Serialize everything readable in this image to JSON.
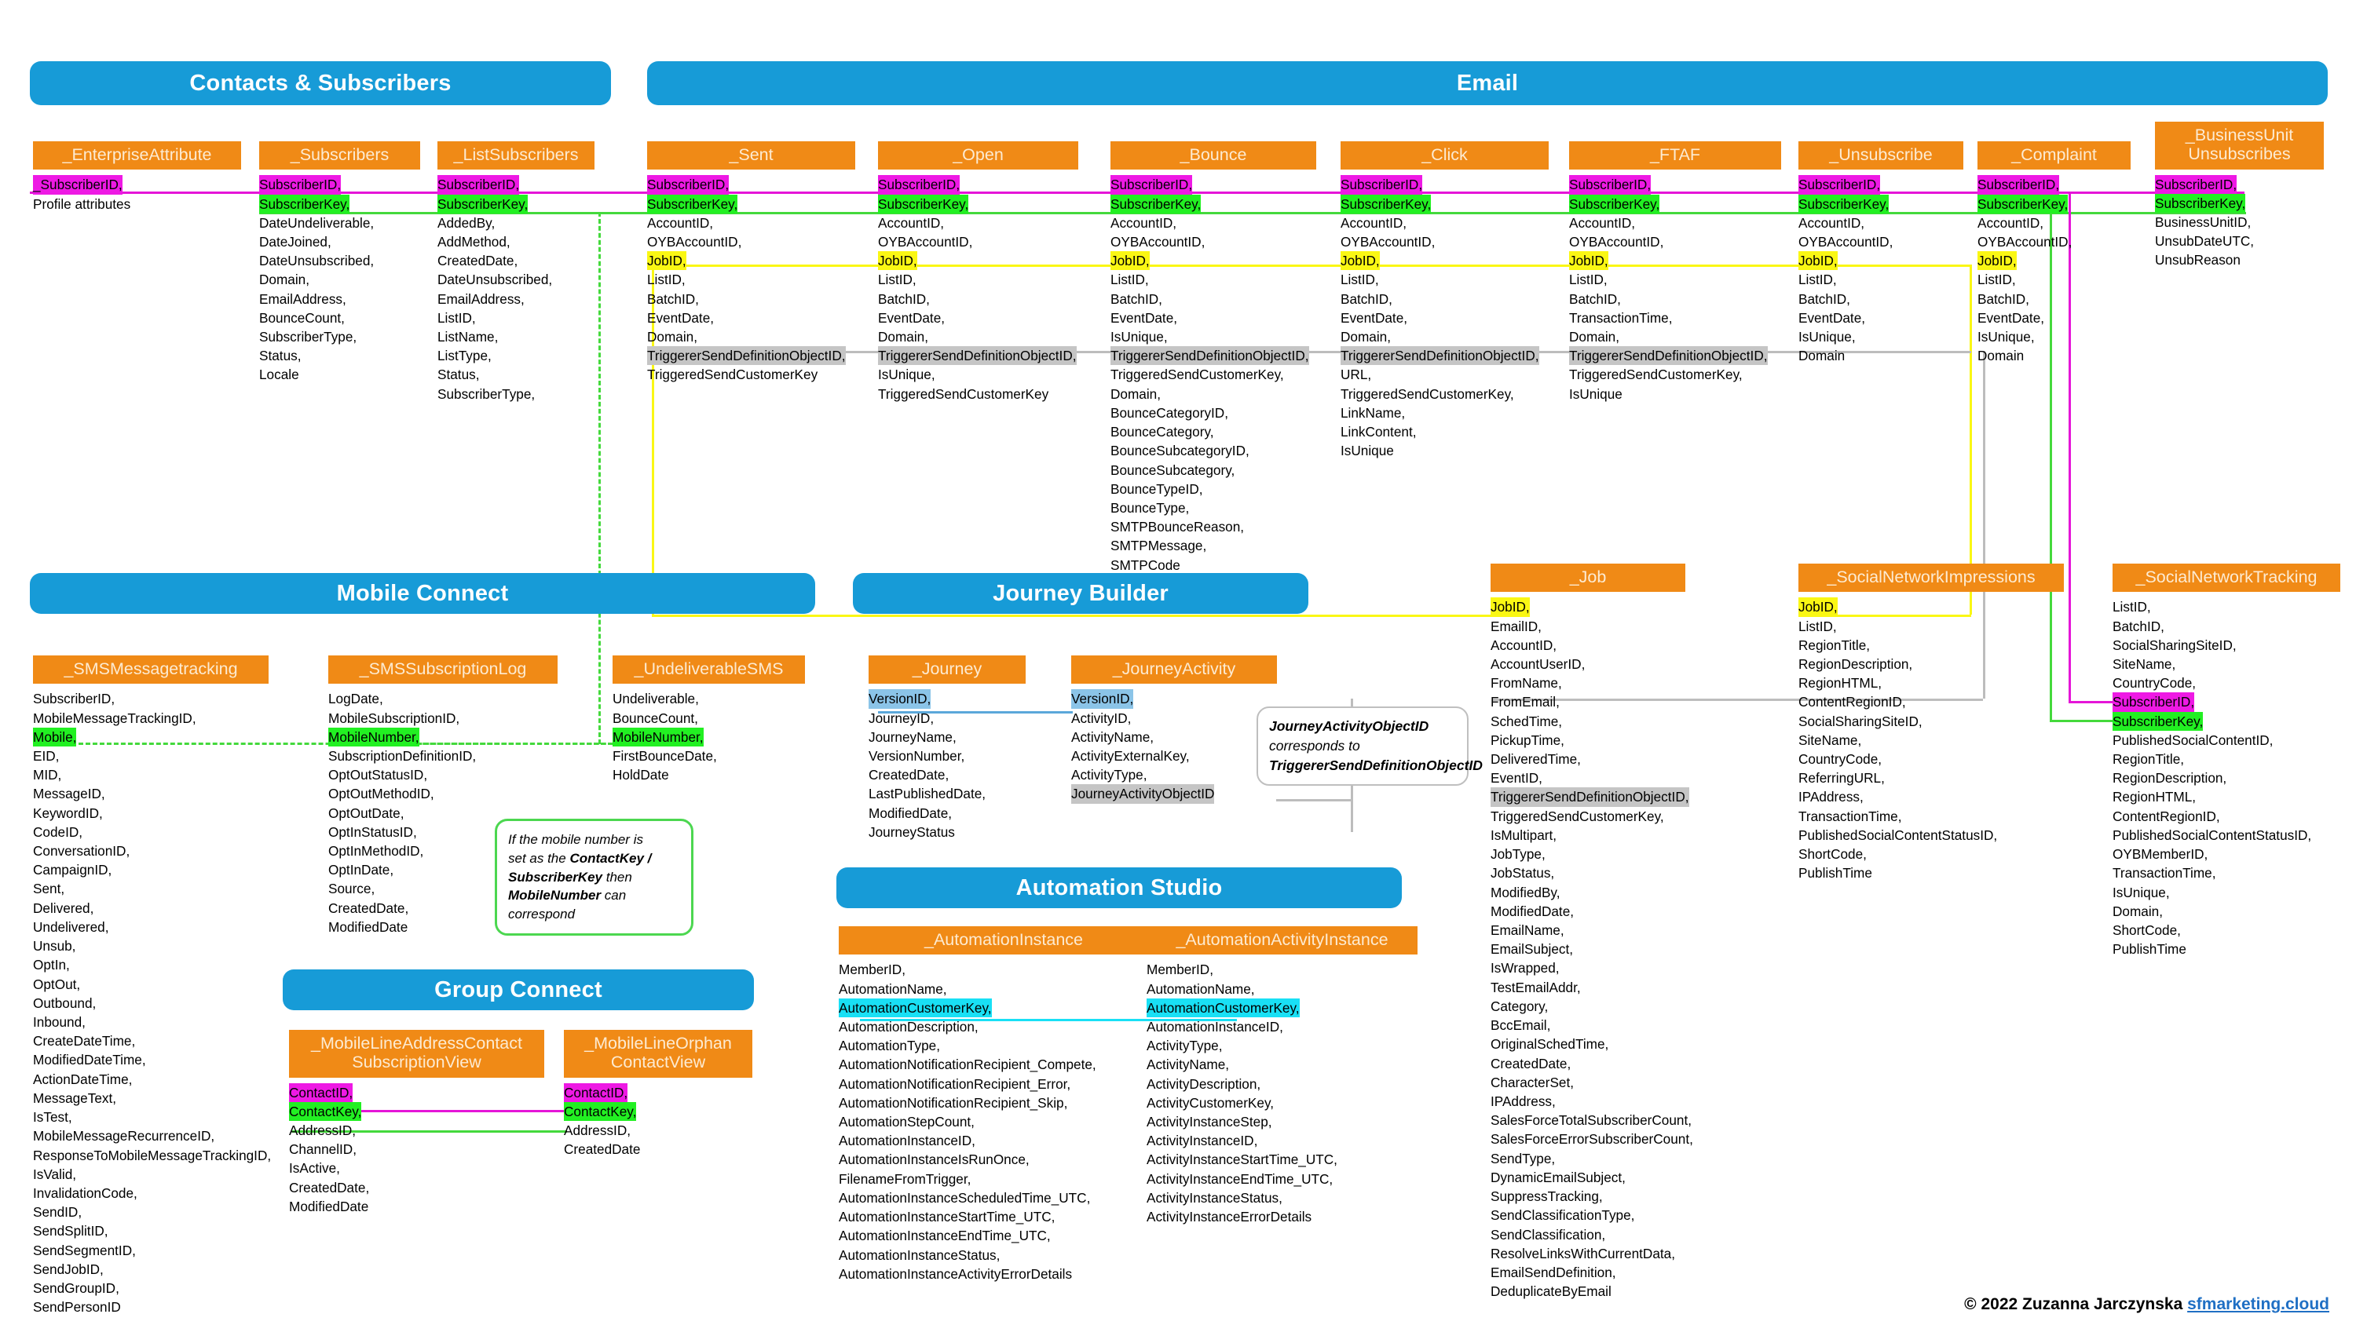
{
  "colors": {
    "banner": "#179BD7",
    "table_header": "#F08A16",
    "primary_key_highlight": "#EE19E4",
    "subscriber_key_highlight": "#22F022",
    "job_id_highlight": "#FAF714",
    "triggered_send_highlight": "#C5C5C5",
    "version_id_highlight": "#8BC4E8",
    "automation_key_highlight": "#19E0F5"
  },
  "sections": {
    "contacts": {
      "title": "Contacts & Subscribers"
    },
    "email": {
      "title": "Email"
    },
    "mobile_connect": {
      "title": "Mobile Connect"
    },
    "journey_builder": {
      "title": "Journey Builder"
    },
    "group_connect": {
      "title": "Group Connect"
    },
    "automation_studio": {
      "title": "Automation Studio"
    }
  },
  "tables": {
    "enterprise_attribute": {
      "name": "_EnterpriseAttribute",
      "fields": [
        "_SubscriberID,",
        "Profile attributes"
      ]
    },
    "subscribers": {
      "name": "_Subscribers",
      "fields": [
        "SubscriberID,",
        "SubscriberKey,",
        "DateUndeliverable,",
        "DateJoined,",
        "DateUnsubscribed,",
        "Domain,",
        "EmailAddress,",
        "BounceCount,",
        "SubscriberType,",
        "Status,",
        "Locale"
      ]
    },
    "list_subscribers": {
      "name": "_ListSubscribers",
      "fields": [
        "SubscriberID,",
        "SubscriberKey,",
        "AddedBy,",
        "AddMethod,",
        "CreatedDate,",
        "DateUnsubscribed,",
        "EmailAddress,",
        "ListID,",
        "ListName,",
        "ListType,",
        "Status,",
        "SubscriberType,"
      ]
    },
    "sent": {
      "name": "_Sent",
      "fields": [
        "SubscriberID,",
        "SubscriberKey,",
        "AccountID,",
        "OYBAccountID,",
        "JobID,",
        "ListID,",
        "BatchID,",
        "EventDate,",
        "Domain,",
        "TriggererSendDefinitionObjectID,",
        "TriggeredSendCustomerKey"
      ]
    },
    "open": {
      "name": "_Open",
      "fields": [
        "SubscriberID,",
        "SubscriberKey,",
        "AccountID,",
        "OYBAccountID,",
        "JobID,",
        "ListID,",
        "BatchID,",
        "EventDate,",
        "Domain,",
        "TriggererSendDefinitionObjectID,",
        "IsUnique,",
        "TriggeredSendCustomerKey"
      ]
    },
    "bounce": {
      "name": "_Bounce",
      "fields": [
        "SubscriberID,",
        "SubscriberKey,",
        "AccountID,",
        "OYBAccountID,",
        "JobID,",
        "ListID,",
        "BatchID,",
        "EventDate,",
        "IsUnique,",
        "TriggererSendDefinitionObjectID,",
        "TriggeredSendCustomerKey,",
        "Domain,",
        "BounceCategoryID,",
        "BounceCategory,",
        "BounceSubcategoryID,",
        "BounceSubcategory,",
        "BounceTypeID,",
        "BounceType,",
        "SMTPBounceReason,",
        "SMTPMessage,",
        "SMTPCode"
      ]
    },
    "click": {
      "name": "_Click",
      "fields": [
        "SubscriberID,",
        "SubscriberKey,",
        "AccountID,",
        "OYBAccountID,",
        "JobID,",
        "ListID,",
        "BatchID,",
        "EventDate,",
        "Domain,",
        "TriggererSendDefinitionObjectID,",
        "URL,",
        "TriggeredSendCustomerKey,",
        "LinkName,",
        "LinkContent,",
        "IsUnique"
      ]
    },
    "ftaf": {
      "name": "_FTAF",
      "fields": [
        "SubscriberID,",
        "SubscriberKey,",
        "AccountID,",
        "OYBAccountID,",
        "JobID,",
        "ListID,",
        "BatchID,",
        "TransactionTime,",
        "Domain,",
        "TriggererSendDefinitionObjectID,",
        "TriggeredSendCustomerKey,",
        "IsUnique"
      ]
    },
    "unsubscribe": {
      "name": "_Unsubscribe",
      "fields": [
        "SubscriberID,",
        "SubscriberKey,",
        "AccountID,",
        "OYBAccountID,",
        "JobID,",
        "ListID,",
        "BatchID,",
        "EventDate,",
        "IsUnique,",
        "Domain"
      ]
    },
    "complaint": {
      "name": "_Complaint",
      "fields": [
        "SubscriberID,",
        "SubscriberKey,",
        "AccountID,",
        "OYBAccountID,",
        "JobID,",
        "ListID,",
        "BatchID,",
        "EventDate,",
        "IsUnique,",
        "Domain"
      ]
    },
    "business_unit_unsubscribes": {
      "name": "_BusinessUnit\nUnsubscribes",
      "fields": [
        "SubscriberID,",
        "SubscriberKey,",
        "BusinessUnitID,",
        "UnsubDateUTC,",
        "UnsubReason"
      ]
    },
    "job": {
      "name": "_Job",
      "fields": [
        "JobID,",
        "EmailID,",
        "AccountID,",
        "AccountUserID,",
        "FromName,",
        "FromEmail,",
        "SchedTime,",
        "PickupTime,",
        "DeliveredTime,",
        "EventID,",
        "TriggererSendDefinitionObjectID,",
        "TriggeredSendCustomerKey,",
        "IsMultipart,",
        "JobType,",
        "JobStatus,",
        "ModifiedBy,",
        "ModifiedDate,",
        "EmailName,",
        "EmailSubject,",
        "IsWrapped,",
        "TestEmailAddr,",
        "Category,",
        "BccEmail,",
        "OriginalSchedTime,",
        "CreatedDate,",
        "CharacterSet,",
        "IPAddress,",
        "SalesForceTotalSubscriberCount,",
        "SalesForceErrorSubscriberCount,",
        "SendType,",
        "DynamicEmailSubject,",
        "SuppressTracking,",
        "SendClassificationType,",
        "SendClassification,",
        "ResolveLinksWithCurrentData,",
        "EmailSendDefinition,",
        "DeduplicateByEmail"
      ]
    },
    "social_network_impressions": {
      "name": "_SocialNetworkImpressions",
      "fields": [
        "JobID,",
        "ListID,",
        "RegionTitle,",
        "RegionDescription,",
        "RegionHTML,",
        "ContentRegionID,",
        "SocialSharingSiteID,",
        "SiteName,",
        "CountryCode,",
        "ReferringURL,",
        "IPAddress,",
        "TransactionTime,",
        "PublishedSocialContentStatusID,",
        "ShortCode,",
        "PublishTime"
      ]
    },
    "social_network_tracking": {
      "name": "_SocialNetworkTracking",
      "fields": [
        "ListID,",
        "BatchID,",
        "SocialSharingSiteID,",
        "SiteName,",
        "CountryCode,",
        "SubscriberID,",
        "SubscriberKey,",
        "PublishedSocialContentID,",
        "RegionTitle,",
        "RegionDescription,",
        "RegionHTML,",
        "ContentRegionID,",
        "PublishedSocialContentStatusID,",
        "OYBMemberID,",
        "TransactionTime,",
        "IsUnique,",
        "Domain,",
        "ShortCode,",
        "PublishTime"
      ]
    },
    "sms_message_tracking": {
      "name": "_SMSMessagetracking",
      "fields": [
        "SubscriberID,",
        "MobileMessageTrackingID,",
        "Mobile,",
        "EID,",
        "MID,",
        "MessageID,",
        "KeywordID,",
        "CodeID,",
        "ConversationID,",
        "CampaignID,",
        "Sent,",
        "Delivered,",
        "Undelivered,",
        "Unsub,",
        "OptIn,",
        "OptOut,",
        "Outbound,",
        "Inbound,",
        "CreateDateTime,",
        "ModifiedDateTime,",
        "ActionDateTime,",
        "MessageText,",
        "IsTest,",
        "MobileMessageRecurrenceID,",
        "ResponseToMobileMessageTrackingID,",
        "IsValid,",
        "InvalidationCode,",
        "SendID,",
        "SendSplitID,",
        "SendSegmentID,",
        "SendJobID,",
        "SendGroupID,",
        "SendPersonID"
      ]
    },
    "sms_subscription_log": {
      "name": "_SMSSubscriptionLog",
      "fields": [
        "LogDate,",
        "MobileSubscriptionID,",
        "MobileNumber,",
        "SubscriptionDefinitionID,",
        "OptOutStatusID,",
        "OptOutMethodID,",
        "OptOutDate,",
        "OptInStatusID,",
        "OptInMethodID,",
        "OptInDate,",
        "Source,",
        "CreatedDate,",
        "ModifiedDate"
      ]
    },
    "undeliverable_sms": {
      "name": "_UndeliverableSMS",
      "fields": [
        "Undeliverable,",
        "BounceCount,",
        "MobileNumber,",
        "FirstBounceDate,",
        "HoldDate"
      ]
    },
    "mobile_line_address_contact_subscription_view": {
      "name": "_MobileLineAddressContact\nSubscriptionView",
      "fields": [
        "ContactID,",
        "ContactKey,",
        "AddressID,",
        "ChannelID,",
        "IsActive,",
        "CreatedDate,",
        "ModifiedDate"
      ]
    },
    "mobile_line_orphan_contact_view": {
      "name": "_MobileLineOrphan\nContactView",
      "fields": [
        "ContactID,",
        "ContactKey,",
        "AddressID,",
        "CreatedDate"
      ]
    },
    "journey": {
      "name": "_Journey",
      "fields": [
        "VersionID,",
        "JourneyID,",
        "JourneyName,",
        "VersionNumber,",
        "CreatedDate,",
        "LastPublishedDate,",
        "ModifiedDate,",
        "JourneyStatus"
      ]
    },
    "journey_activity": {
      "name": "_JourneyActivity",
      "fields": [
        "VersionID,",
        "ActivityID,",
        "ActivityName,",
        "ActivityExternalKey,",
        "ActivityType,",
        "JourneyActivityObjectID"
      ]
    },
    "automation_instance": {
      "name": "_AutomationInstance",
      "fields": [
        "MemberID,",
        "AutomationName,",
        "AutomationCustomerKey,",
        "AutomationDescription,",
        "AutomationType,",
        "AutomationNotificationRecipient_Compete,",
        "AutomationNotificationRecipient_Error,",
        "AutomationNotificationRecipient_Skip,",
        "AutomationStepCount,",
        "AutomationInstanceID,",
        "AutomationInstanceIsRunOnce,",
        "FilenameFromTrigger,",
        "AutomationInstanceScheduledTime_UTC,",
        "AutomationInstanceStartTime_UTC,",
        "AutomationInstanceEndTime_UTC,",
        "AutomationInstanceStatus,",
        "AutomationInstanceActivityErrorDetails"
      ]
    },
    "automation_activity_instance": {
      "name": "_AutomationActivityInstance",
      "fields": [
        "MemberID,",
        "AutomationName,",
        "AutomationCustomerKey,",
        "AutomationInstanceID,",
        "ActivityType,",
        "ActivityName,",
        "ActivityDescription,",
        "ActivityCustomerKey,",
        "ActivityInstanceStep,",
        "ActivityInstanceID,",
        "ActivityInstanceStartTime_UTC,",
        "ActivityInstanceEndTime_UTC,",
        "ActivityInstanceStatus,",
        "ActivityInstanceErrorDetails"
      ]
    }
  },
  "notes": {
    "mobile_note": "If the mobile number is set as the ContactKey / SubscriberKey then MobileNumber can correspond",
    "mobile_note_parts": {
      "l1": "If the mobile number is",
      "l2a": "set as the ",
      "l2b": "ContactKey /",
      "l3a": "SubscriberKey",
      "l3b": " then",
      "l4a": "MobileNumber",
      "l4b": " can",
      "l5": "correspond"
    },
    "journey_note_parts": {
      "l1": "JourneyActivityObjectID",
      "l2": "corresponds to",
      "l3": "TriggererSendDefinitionObjectID"
    }
  },
  "footer": {
    "copyright": "© 2022 Zuzanna Jarczynska ",
    "link": "sfmarketing.cloud"
  }
}
